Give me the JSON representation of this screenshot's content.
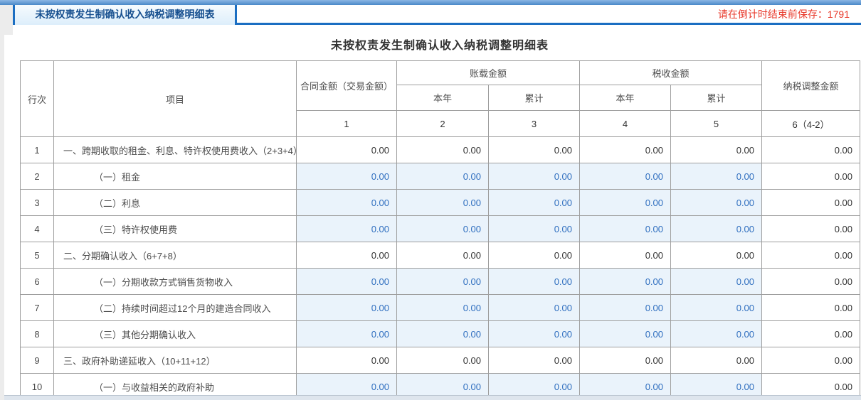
{
  "top": {
    "tab_title": "未按权责发生制确认收入纳税调整明细表",
    "countdown_label": "请在倒计时结束前保存：",
    "countdown_value": "1791"
  },
  "colors": {
    "accent_blue": "#1b6ec2",
    "tab_text_blue": "#164f8f",
    "alert_red": "#e8392b",
    "editable_cell_bg": "#eaf3fb",
    "editable_cell_text": "#2f6ebf"
  },
  "form": {
    "title": "未按权责发生制确认收入纳税调整明细表",
    "header": {
      "row_no": "行次",
      "item": "项目",
      "contract_amount": "合同金额（交易金额）",
      "book_amount": "账载金额",
      "tax_amount": "税收金额",
      "adjust_amount": "纳税调整金额",
      "book_current_year": "本年",
      "book_cumulative": "累计",
      "tax_current_year": "本年",
      "tax_cumulative": "累计",
      "col_nums": [
        "1",
        "2",
        "3",
        "4",
        "5",
        "6（4-2）"
      ]
    },
    "rows": [
      {
        "no": "1",
        "type": "summary",
        "item": "一、跨期收取的租金、利息、特许权使用费收入（2+3+4）",
        "values": [
          "0.00",
          "0.00",
          "0.00",
          "0.00",
          "0.00",
          "0.00"
        ]
      },
      {
        "no": "2",
        "type": "detail",
        "item": "（一）租金",
        "values": [
          "0.00",
          "0.00",
          "0.00",
          "0.00",
          "0.00",
          "0.00"
        ]
      },
      {
        "no": "3",
        "type": "detail",
        "item": "（二）利息",
        "values": [
          "0.00",
          "0.00",
          "0.00",
          "0.00",
          "0.00",
          "0.00"
        ]
      },
      {
        "no": "4",
        "type": "detail",
        "item": "（三）特许权使用费",
        "values": [
          "0.00",
          "0.00",
          "0.00",
          "0.00",
          "0.00",
          "0.00"
        ]
      },
      {
        "no": "5",
        "type": "summary",
        "item": "二、分期确认收入（6+7+8）",
        "values": [
          "0.00",
          "0.00",
          "0.00",
          "0.00",
          "0.00",
          "0.00"
        ]
      },
      {
        "no": "6",
        "type": "detail",
        "item": "（一）分期收款方式销售货物收入",
        "values": [
          "0.00",
          "0.00",
          "0.00",
          "0.00",
          "0.00",
          "0.00"
        ]
      },
      {
        "no": "7",
        "type": "detail",
        "item": "（二）持续时间超过12个月的建造合同收入",
        "values": [
          "0.00",
          "0.00",
          "0.00",
          "0.00",
          "0.00",
          "0.00"
        ]
      },
      {
        "no": "8",
        "type": "detail",
        "item": "（三）其他分期确认收入",
        "values": [
          "0.00",
          "0.00",
          "0.00",
          "0.00",
          "0.00",
          "0.00"
        ]
      },
      {
        "no": "9",
        "type": "summary",
        "item": "三、政府补助递延收入（10+11+12）",
        "values": [
          "0.00",
          "0.00",
          "0.00",
          "0.00",
          "0.00",
          "0.00"
        ]
      },
      {
        "no": "10",
        "type": "detail",
        "item": "（一）与收益相关的政府补助",
        "values": [
          "0.00",
          "0.00",
          "0.00",
          "0.00",
          "0.00",
          "0.00"
        ]
      }
    ]
  }
}
